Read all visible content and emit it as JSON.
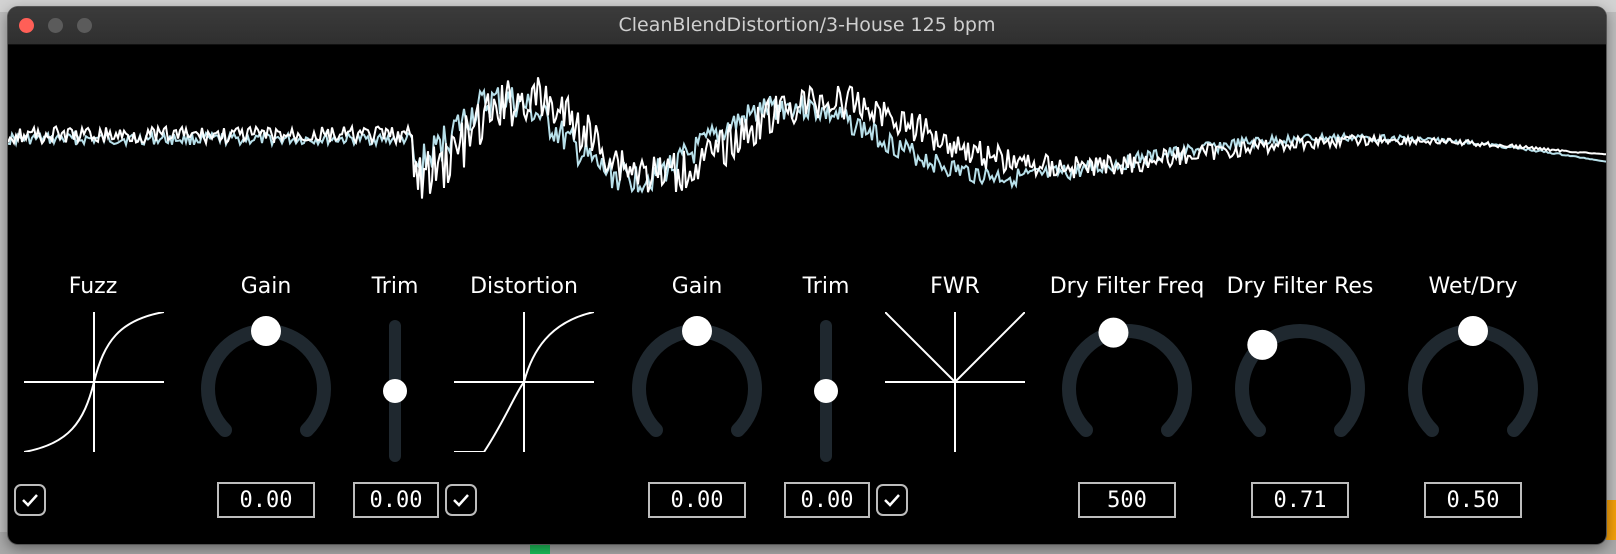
{
  "window": {
    "title": "CleanBlendDistortion/3-House 125 bpm"
  },
  "colors": {
    "background": "#000000",
    "track": "#1f282f",
    "handle": "#ffffff",
    "wave_dry": "#ffffff",
    "wave_wet": "#b8e0ea"
  },
  "controls": {
    "fuzz": {
      "label": "Fuzz",
      "enabled": true,
      "icon": "fuzz-curve-icon"
    },
    "gain1": {
      "label": "Gain",
      "value": "0.00",
      "level": 0.5
    },
    "trim1": {
      "label": "Trim",
      "value": "0.00",
      "level": 0.5
    },
    "distortion": {
      "label": "Distortion",
      "enabled": true,
      "icon": "distortion-curve-icon"
    },
    "gain2": {
      "label": "Gain",
      "value": "0.00",
      "level": 0.5
    },
    "trim2": {
      "label": "Trim",
      "value": "0.00",
      "level": 0.5
    },
    "fwr": {
      "label": "FWR",
      "enabled": true,
      "icon": "fwr-curve-icon"
    },
    "dry_filter_freq": {
      "label": "Dry Filter Freq",
      "value": "500",
      "level": 0.45
    },
    "dry_filter_res": {
      "label": "Dry Filter Res",
      "value": "0.71",
      "level": 0.35
    },
    "wet_dry": {
      "label": "Wet/Dry",
      "value": "0.50",
      "level": 0.5
    }
  }
}
